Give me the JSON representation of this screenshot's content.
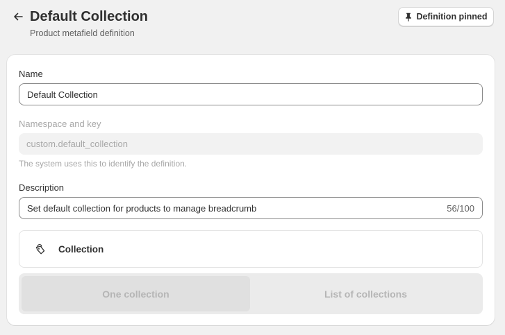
{
  "header": {
    "title": "Default Collection",
    "subtitle": "Product metafield definition",
    "pin_label": "Definition pinned",
    "back_icon": "arrow-left-icon",
    "pin_icon": "pin-icon"
  },
  "form": {
    "name": {
      "label": "Name",
      "value": "Default Collection"
    },
    "namespace": {
      "label": "Namespace and key",
      "value": "custom.default_collection",
      "help": "The system uses this to identify the definition."
    },
    "description": {
      "label": "Description",
      "value": "Set default collection for products to manage breadcrumb",
      "counter": "56/100"
    },
    "type": {
      "label": "Collection",
      "icon": "collection-icon"
    },
    "cardinality": {
      "options": [
        "One collection",
        "List of collections"
      ],
      "selected": "One collection"
    }
  },
  "colors": {
    "background": "#f1f1f1",
    "card": "#ffffff",
    "text": "#303030",
    "muted_text": "#a8a8a8"
  }
}
